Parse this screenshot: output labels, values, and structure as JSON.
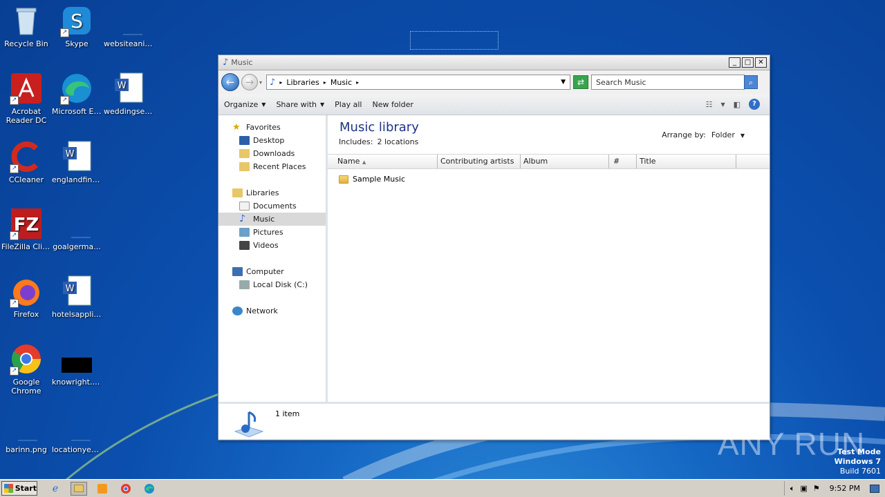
{
  "desktop": {
    "icons": [
      {
        "label": "Recycle Bin"
      },
      {
        "label": "Skype"
      },
      {
        "label": "websiteanim..."
      },
      {
        "label": "Acrobat Reader DC"
      },
      {
        "label": "Microsoft Edge"
      },
      {
        "label": "weddingset..."
      },
      {
        "label": "CCleaner"
      },
      {
        "label": "englandfina..."
      },
      {
        "label": "FileZilla Client"
      },
      {
        "label": "goalgerma..."
      },
      {
        "label": "Firefox"
      },
      {
        "label": "hotelsapplic..."
      },
      {
        "label": "Google Chrome"
      },
      {
        "label": "knowright.jpg"
      },
      {
        "label": "barinn.png"
      },
      {
        "label": "locationyebi..."
      }
    ]
  },
  "window": {
    "title": "Music",
    "address": {
      "crumbs": [
        "Libraries",
        "Music"
      ]
    },
    "search_placeholder": "Search Music",
    "toolbar": {
      "organize": "Organize",
      "share_with": "Share with",
      "play_all": "Play all",
      "new_folder": "New folder"
    },
    "nav": {
      "favorites": "Favorites",
      "desktop": "Desktop",
      "downloads": "Downloads",
      "recent": "Recent Places",
      "libraries": "Libraries",
      "documents": "Documents",
      "music": "Music",
      "pictures": "Pictures",
      "videos": "Videos",
      "computer": "Computer",
      "local_disk": "Local Disk (C:)",
      "network": "Network"
    },
    "library": {
      "title": "Music library",
      "includes_label": "Includes:",
      "includes_value": "2 locations",
      "arrange_label": "Arrange by:",
      "arrange_value": "Folder"
    },
    "columns": [
      "Name",
      "Contributing artists",
      "Album",
      "#",
      "Title"
    ],
    "items": [
      {
        "name": "Sample Music"
      }
    ],
    "status": "1 item"
  },
  "taskbar": {
    "start": "Start",
    "clock": "9:52 PM"
  },
  "watermark": {
    "line1": "Test Mode",
    "line2": "Windows 7",
    "line3": "Build 7601",
    "brand": "ANY RUN"
  },
  "colors": {
    "desktop": "#0b4fae",
    "library_title": "#1e3287"
  }
}
